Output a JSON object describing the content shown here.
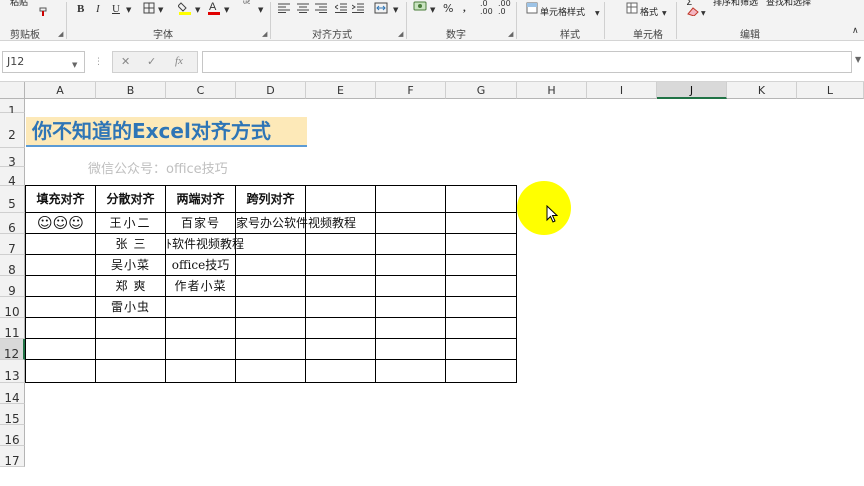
{
  "ribbon": {
    "clipboard": {
      "paste_label": "粘贴",
      "group_label": "剪贴板"
    },
    "font": {
      "bold": "B",
      "italic": "I",
      "underline": "U",
      "border_icon": "border-icon",
      "fill_icon": "fill-color-icon",
      "font_color_icon": "font-color-icon",
      "phonetic_icon": "phonetic-icon",
      "group_label": "字体"
    },
    "alignment": {
      "wrap_icon": "wrap-text-icon",
      "merge_icon": "merge-center-icon",
      "group_label": "对齐方式"
    },
    "number": {
      "currency_icon": "currency-icon",
      "percent": "%",
      "comma": ",",
      "group_label": "数字"
    },
    "styles": {
      "cell_styles": "单元格样式",
      "group_label": "样式"
    },
    "cells": {
      "format": "格式",
      "group_label": "单元格"
    },
    "editing": {
      "sort_filter": "排序和筛选",
      "find_select": "查找和选择",
      "group_label": "编辑"
    }
  },
  "formula_bar": {
    "name_box": "J12",
    "cancel": "✕",
    "enter": "✓",
    "fx": "fx",
    "formula": ""
  },
  "columns": [
    "A",
    "B",
    "C",
    "D",
    "E",
    "F",
    "G",
    "H",
    "I",
    "J",
    "K",
    "L"
  ],
  "selected_column": "J",
  "rows": [
    "1",
    "2",
    "3",
    "4",
    "5",
    "6",
    "7",
    "8",
    "9",
    "10",
    "11",
    "12",
    "13",
    "14",
    "15",
    "16",
    "17"
  ],
  "selected_row": "12",
  "sheet": {
    "title": "你不知道的Excel对齐方式",
    "subtitle": "微信公众号：office技巧",
    "headers": [
      "填充对齐",
      "分散对齐",
      "两端对齐",
      "跨列对齐"
    ],
    "r5": {
      "a": "☺☺☺",
      "b": "王小二",
      "c": "百家号",
      "d": "家号办公软件视频教程"
    },
    "r6": {
      "b": "张三",
      "c": "ﾄ软件视频教程"
    },
    "r7": {
      "b": "吴小菜",
      "c": "office技巧"
    },
    "r8": {
      "b": "郑爽",
      "c": "作者小菜"
    },
    "r9": {
      "b": "雷小虫"
    }
  },
  "colors": {
    "title_fill": "#fde9b8",
    "title_text": "#2e75b6",
    "title_underline": "#5b9bd5",
    "highlight": "#ffff00",
    "selected_header_accent": "#217346"
  }
}
